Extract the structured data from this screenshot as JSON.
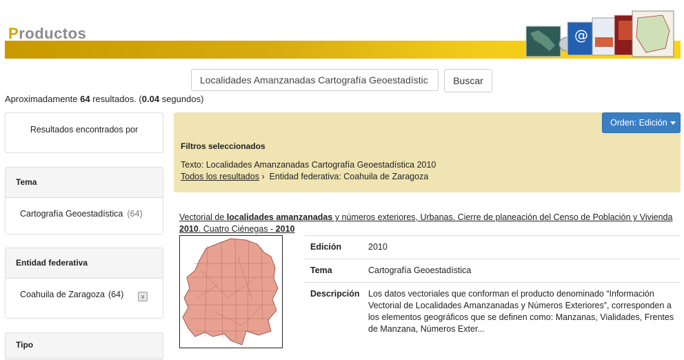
{
  "header": {
    "title_first": "P",
    "title_rest": "roductos"
  },
  "search": {
    "value": "Localidades Amanzanadas Cartografía Geoestadístic",
    "button_label": "Buscar"
  },
  "summary": {
    "prefix": "Aproximadamente",
    "count": "64",
    "mid": "resultados. (",
    "seconds": "0.04",
    "suffix": "segundos)"
  },
  "sidebar": {
    "found_label": "Resultados encontrados por",
    "tema": {
      "heading": "Tema",
      "item": "Cartografía Geoestadística",
      "count": "(64)"
    },
    "entidad": {
      "heading": "Entidad federativa",
      "item": "Coahuila de Zaragoza",
      "count": "(64)",
      "remove": "x"
    },
    "tipo": {
      "heading": "Tipo"
    }
  },
  "filters": {
    "order_label": "Orden: Edición",
    "title": "Filtros seleccionados",
    "text": "Texto: Localidades Amanzanadas Cartografía Geoestadística 2010",
    "all_results": "Todos los resultados",
    "separator": "›",
    "entity": "Entidad federativa: Coahuila de Zaragoza"
  },
  "result": {
    "title_a": "Vectorial de ",
    "title_b": "localidades amanzanadas",
    "title_c": " y números exteriores, Urbanas. Cierre de planeación del Censo de Población y Vivienda ",
    "title_d": "2010",
    "title_e": ". Cuatro Ciénegas - ",
    "title_f": "2010",
    "edicion_label": "Edición",
    "edicion": "2010",
    "tema_label": "Tema",
    "tema": "Cartografía Geoestadística",
    "descripcion_label": "Descripción",
    "descripcion": "Los datos vectoriales que conforman el producto denominado “Información Vectorial de Localidades Amanzanadas y Números Exteriores”, corresponden a los elementos geográficos que se definen como: Manzanas, Vialidades, Frentes de Manzana, Números Exter..."
  },
  "colors": {
    "accent_gold": "#d6a200",
    "filters_bg": "#f0e4b3",
    "button_blue": "#3a7fc4",
    "map_fill": "#e8a090"
  }
}
